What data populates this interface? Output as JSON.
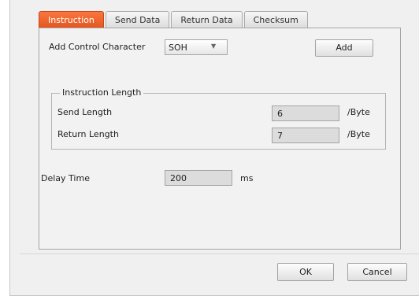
{
  "tabs": [
    {
      "label": "Instruction",
      "active": true
    },
    {
      "label": "Send Data",
      "active": false
    },
    {
      "label": "Return Data",
      "active": false
    },
    {
      "label": "Checksum",
      "active": false
    }
  ],
  "instruction": {
    "control_char_label": "Add Control Character",
    "control_char_value": "SOH",
    "add_button": "Add",
    "length_group_title": "Instruction Length",
    "send_length_label": "Send Length",
    "send_length_value": "6",
    "send_length_unit": "/Byte",
    "return_length_label": "Return Length",
    "return_length_value": "7",
    "return_length_unit": "/Byte",
    "delay_label": "Delay Time",
    "delay_value": "200",
    "delay_unit": "ms"
  },
  "footer": {
    "ok_button": "OK",
    "cancel_button": "Cancel"
  },
  "colors": {
    "active_tab": "#f26a2e",
    "dialog_bg": "#f0f0f0"
  },
  "icons": {
    "dropdown": "chevron-down-icon"
  }
}
